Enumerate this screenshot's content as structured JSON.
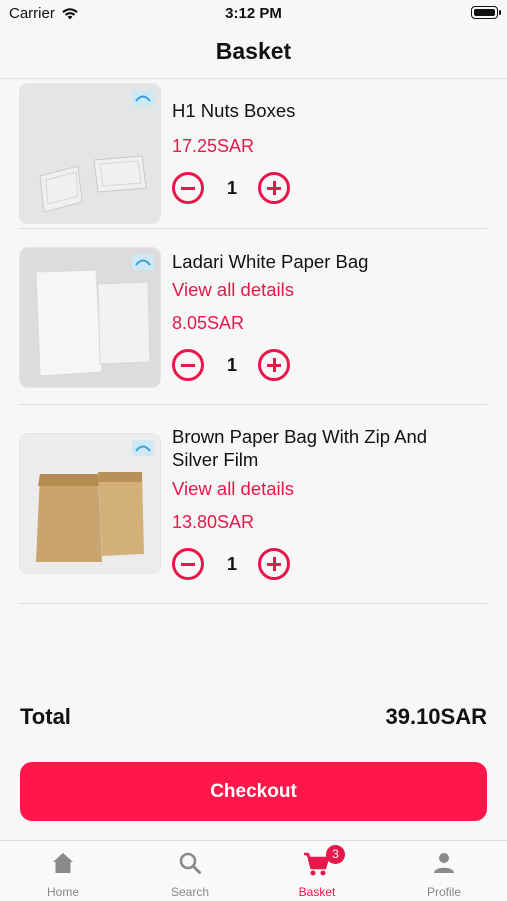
{
  "status": {
    "carrier": "Carrier",
    "time": "3:12 PM"
  },
  "header": {
    "title": "Basket"
  },
  "items": [
    {
      "name": "H1 Nuts Boxes",
      "price": "17.25SAR",
      "qty": "1"
    },
    {
      "name": "Ladari White Paper Bag",
      "details": "View all details",
      "price": "8.05SAR",
      "qty": "1"
    },
    {
      "name": "Brown Paper Bag With Zip And Silver Film",
      "details": "View all details",
      "price": "13.80SAR",
      "qty": "1"
    }
  ],
  "summary": {
    "total_label": "Total",
    "total_value": "39.10SAR"
  },
  "checkout": {
    "label": "Checkout"
  },
  "tabs": [
    {
      "label": "Home",
      "icon": "home-icon"
    },
    {
      "label": "Search",
      "icon": "search-icon"
    },
    {
      "label": "Basket",
      "icon": "cart-icon",
      "badge": "3",
      "active": true
    },
    {
      "label": "Profile",
      "icon": "profile-icon"
    }
  ],
  "colors": {
    "accent": "#e8174a",
    "checkout_bg": "#ff1749",
    "tab_inactive": "#888888"
  }
}
